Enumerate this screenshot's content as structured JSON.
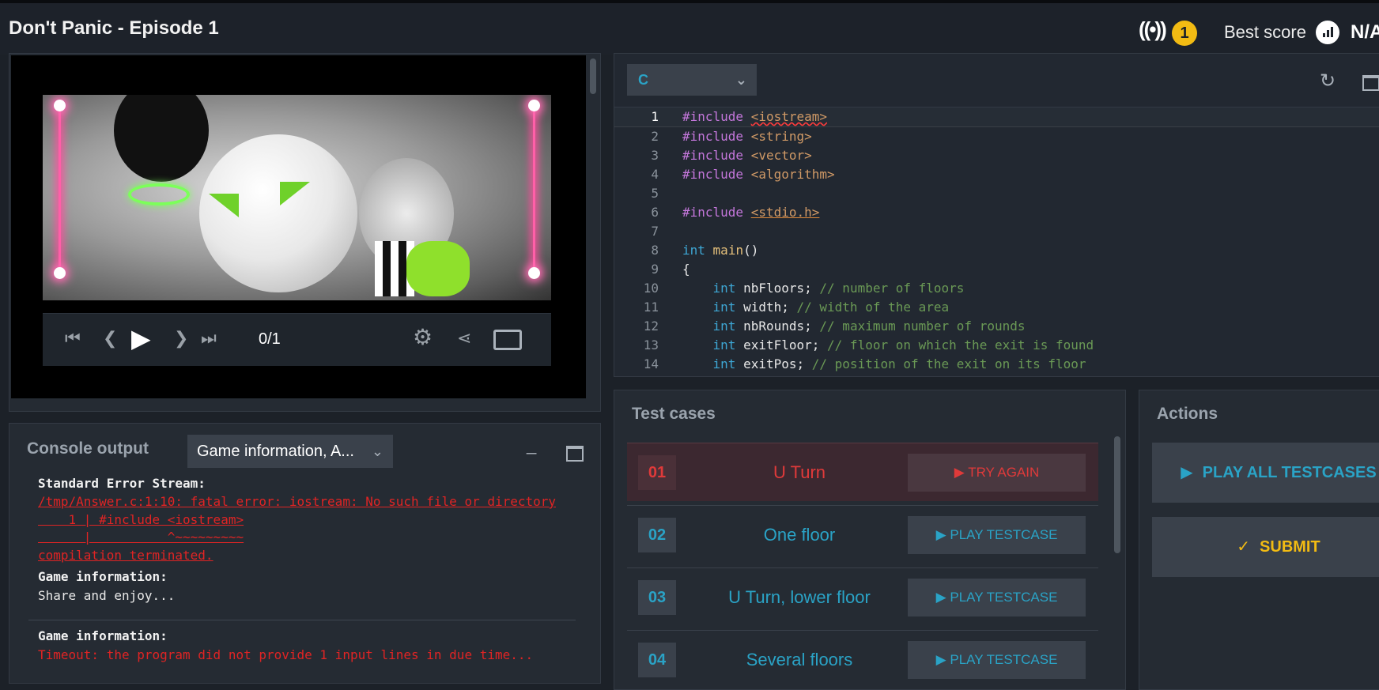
{
  "header": {
    "title": "Don't Panic - Episode 1",
    "live_count": "1",
    "best_score_label": "Best score",
    "best_score_value": "N/A"
  },
  "player": {
    "frame": "0/1"
  },
  "console": {
    "title": "Console output",
    "filter": "Game information, A...",
    "stderr_label": "Standard Error Stream:",
    "errors": [
      "/tmp/Answer.c:1:10: fatal error: iostream: No such file or directory",
      "    1 | #include <iostream>",
      "      |          ^~~~~~~~~~",
      "compilation terminated."
    ],
    "info_label_1": "Game information:",
    "info_text_1": "Share and enjoy...",
    "info_label_2": "Game information:",
    "info_text_2": "Timeout: the program did not provide 1 input lines in due time..."
  },
  "editor": {
    "language": "C",
    "lines": [
      {
        "n": "1",
        "a": "#include ",
        "b": "<iostream>"
      },
      {
        "n": "2",
        "a": "#include ",
        "b": "<string>"
      },
      {
        "n": "3",
        "a": "#include ",
        "b": "<vector>"
      },
      {
        "n": "4",
        "a": "#include ",
        "b": "<algorithm>"
      },
      {
        "n": "5"
      },
      {
        "n": "6",
        "a": "#include ",
        "b": "<stdio.h>"
      },
      {
        "n": "7"
      },
      {
        "n": "8",
        "kw": "int",
        "fn": "main",
        "rest": "()"
      },
      {
        "n": "9",
        "rest": "{"
      },
      {
        "n": "10",
        "kw": "int",
        "rest": " nbFloors; ",
        "cm": "// number of floors"
      },
      {
        "n": "11",
        "kw": "int",
        "rest": " width; ",
        "cm": "// width of the area"
      },
      {
        "n": "12",
        "kw": "int",
        "rest": " nbRounds; ",
        "cm": "// maximum number of rounds"
      },
      {
        "n": "13",
        "kw": "int",
        "rest": " exitFloor; ",
        "cm": "// floor on which the exit is found"
      },
      {
        "n": "14",
        "kw": "int",
        "rest": " exitPos; ",
        "cm": "// position of the exit on its floor"
      }
    ]
  },
  "tests": {
    "title": "Test cases",
    "items": [
      {
        "num": "01",
        "name": "U Turn",
        "action": "TRY AGAIN"
      },
      {
        "num": "02",
        "name": "One floor",
        "action": "PLAY TESTCASE"
      },
      {
        "num": "03",
        "name": "U Turn, lower floor",
        "action": "PLAY TESTCASE"
      },
      {
        "num": "04",
        "name": "Several floors",
        "action": "PLAY TESTCASE"
      }
    ]
  },
  "actions": {
    "title": "Actions",
    "play_all": "PLAY ALL TESTCASES",
    "submit": "SUBMIT"
  },
  "colors": {
    "accent": "#2aa3c6",
    "error": "#e03a3a",
    "gold": "#f2bb13"
  }
}
